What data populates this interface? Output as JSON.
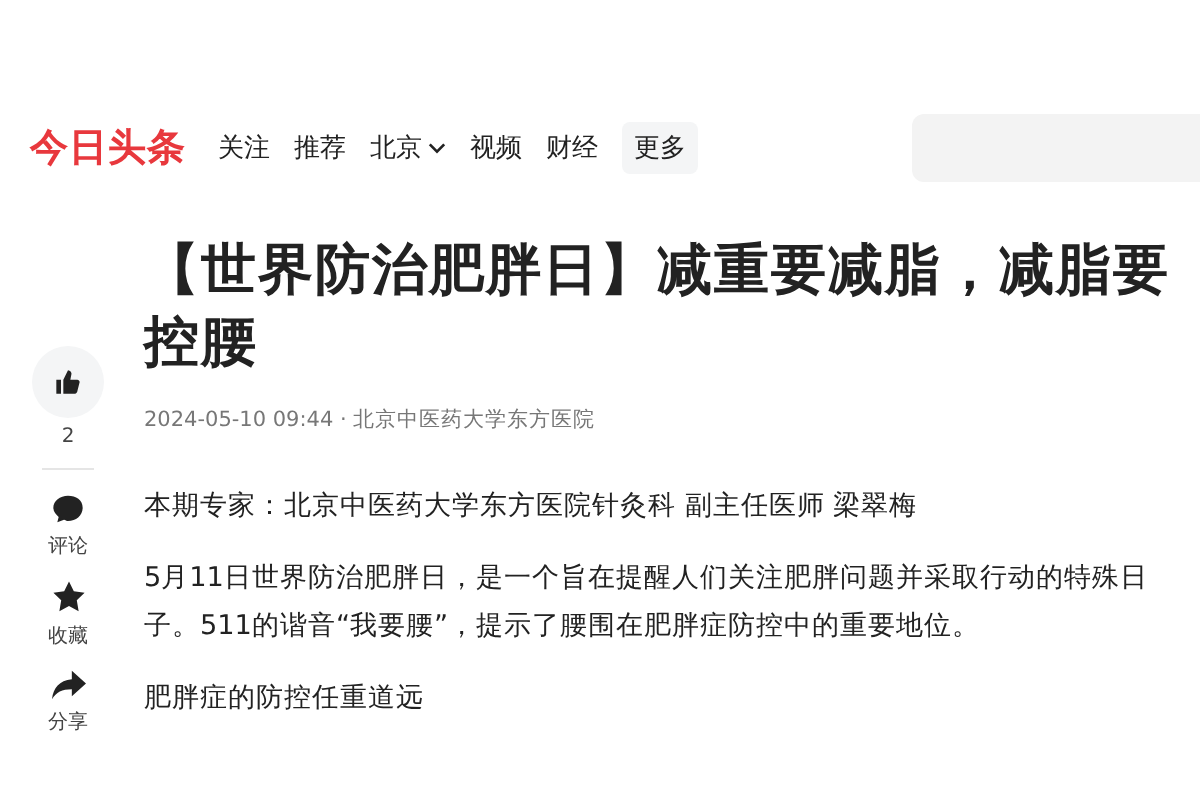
{
  "header": {
    "logo": "今日头条",
    "nav": [
      {
        "label": "关注",
        "kind": "link"
      },
      {
        "label": "推荐",
        "kind": "link"
      },
      {
        "label": "北京",
        "kind": "dropdown"
      },
      {
        "label": "视频",
        "kind": "link"
      },
      {
        "label": "财经",
        "kind": "link"
      },
      {
        "label": "更多",
        "kind": "more"
      }
    ],
    "search": {
      "kind": "search"
    }
  },
  "rail": [
    {
      "kind": "like",
      "label": "2"
    },
    {
      "kind": "comment",
      "label": "评论"
    },
    {
      "kind": "star",
      "label": "收藏"
    },
    {
      "kind": "share",
      "label": "分享"
    }
  ],
  "article": {
    "title": "【世界防治肥胖日】减重要减脂，减脂要控腰",
    "meta": "2024-05-10 09:44 · 北京中医药大学东方医院",
    "paragraphs": [
      "本期专家：北京中医药大学东方医院针灸科 副主任医师 梁翠梅",
      "5月11日世界防治肥胖日，是一个旨在提醒人们关注肥胖问题并采取行动的特殊日子。511的谐音“我要腰”，提示了腰围在肥胖症防控中的重要地位。",
      "肥胖症的防控任重道远"
    ]
  }
}
